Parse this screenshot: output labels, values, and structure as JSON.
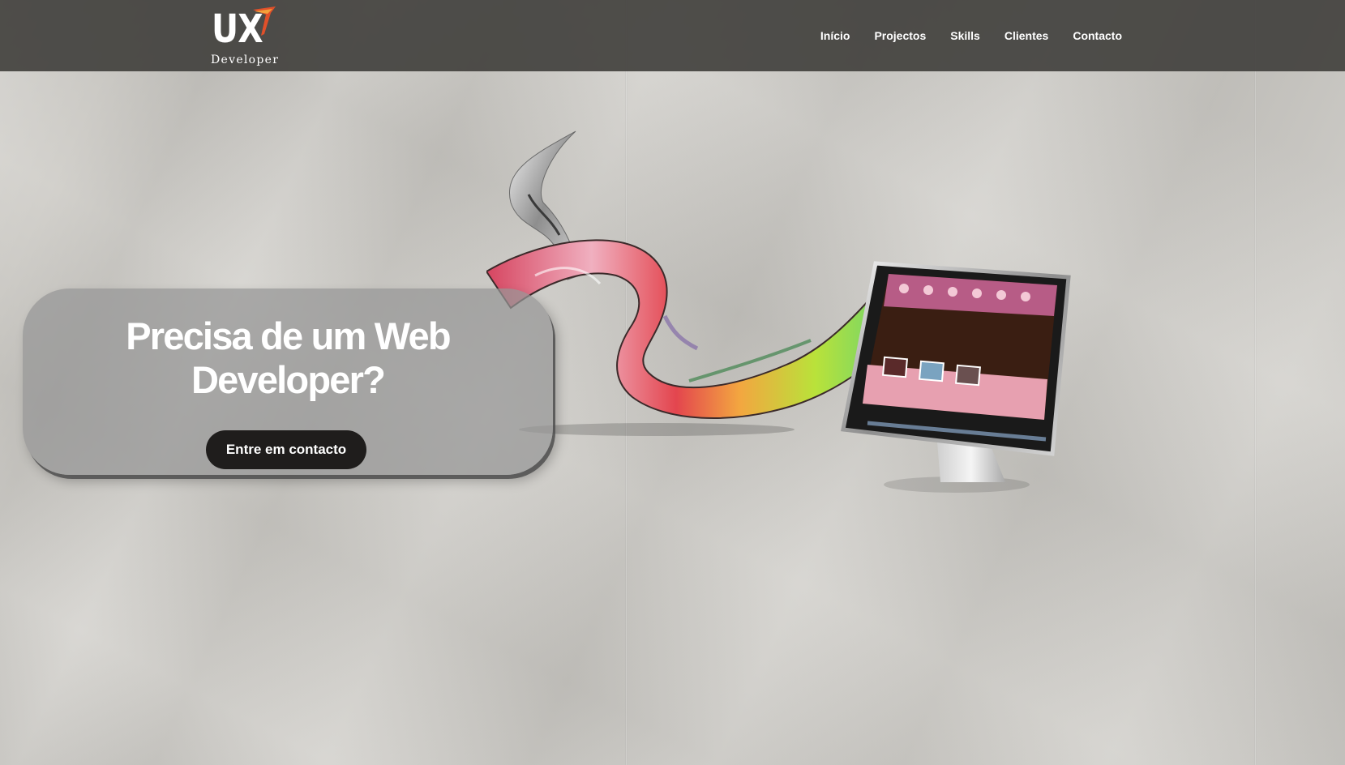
{
  "logo": {
    "mark": "UX",
    "subtitle": "Developer",
    "icon": "logo-swoosh-icon"
  },
  "nav": {
    "items": [
      {
        "label": "Início"
      },
      {
        "label": "Projectos"
      },
      {
        "label": "Skills"
      },
      {
        "label": "Clientes"
      },
      {
        "label": "Contacto"
      }
    ]
  },
  "hero": {
    "title_line1": "Precisa de um Web",
    "title_line2": "Developer?",
    "cta_label": "Entre em contacto"
  },
  "illustration": {
    "icon": "monitor-ribbon-illustration"
  },
  "colors": {
    "header_bg": "#42413e",
    "button_bg": "#1f1d1c",
    "text_light": "#ffffff",
    "logo_accent": "#e0502a"
  }
}
